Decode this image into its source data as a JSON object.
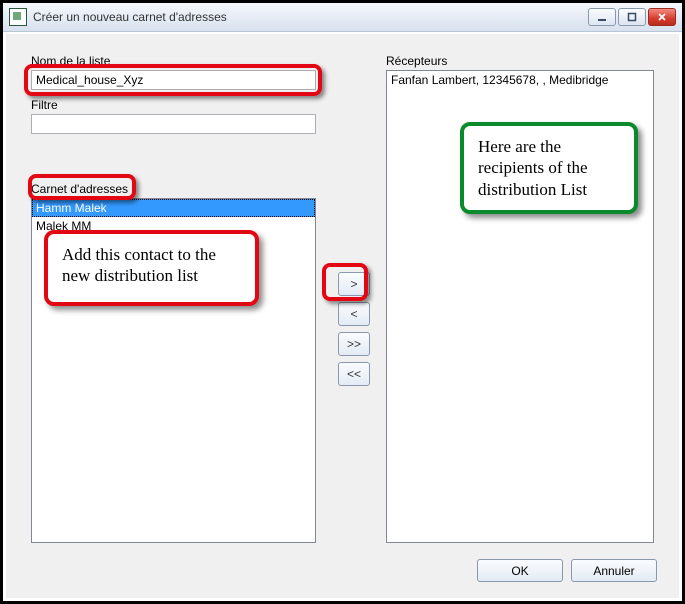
{
  "window": {
    "title": "Créer un nouveau carnet d'adresses"
  },
  "labels": {
    "list_name": "Nom de la liste",
    "filter": "Filtre",
    "addressbook": "Carnet d'adresses",
    "receivers": "Récepteurs"
  },
  "fields": {
    "list_name_value": "Medical_house_Xyz",
    "filter_value": ""
  },
  "addressbook_items": [
    {
      "text": "Hamm Malek",
      "selected": true
    },
    {
      "text": "Malek MM",
      "selected": false
    }
  ],
  "receivers_items": [
    {
      "text": "Fanfan Lambert, 12345678, , Medibridge"
    }
  ],
  "transfer_buttons": {
    "add_one": ">",
    "remove_one": "<",
    "add_all": ">>",
    "remove_all": "<<"
  },
  "buttons": {
    "ok": "OK",
    "cancel": "Annuler"
  },
  "annotations": {
    "red_callout": "Add this contact to the new distribution list",
    "green_callout": "Here are the recipients of the distribution List"
  }
}
